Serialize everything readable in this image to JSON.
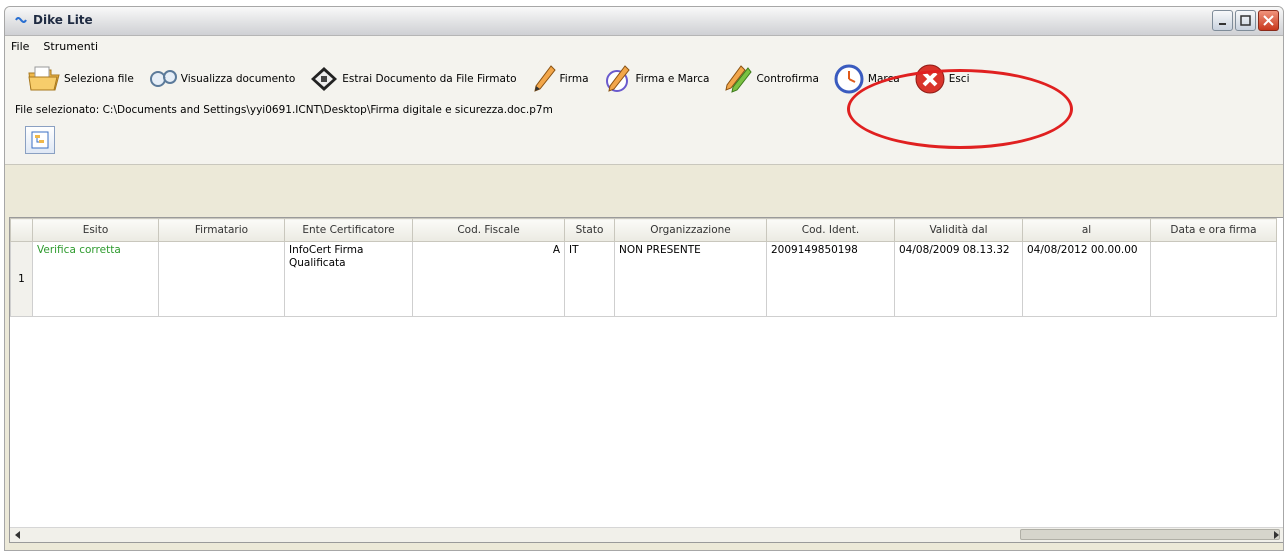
{
  "window": {
    "title": "Dike Lite"
  },
  "menu": {
    "file": "File",
    "tools": "Strumenti"
  },
  "toolbar": {
    "select_file": "Seleziona file",
    "view_document": "Visualizza documento",
    "extract_document": "Estrai Documento da File Firmato",
    "sign": "Firma",
    "sign_and_stamp": "Firma e Marca",
    "countersign": "Controfirma",
    "stamp": "Marca",
    "exit": "Esci"
  },
  "file_bar": {
    "text": "File selezionato: C:\\Documents and Settings\\yyi0691.ICNT\\Desktop\\Firma digitale e sicurezza.doc.p7m"
  },
  "table": {
    "headers": [
      "Esito",
      "Firmatario",
      "Ente Certificatore",
      "Cod. Fiscale",
      "Stato",
      "Organizzazione",
      "Cod. Ident.",
      "Validità dal",
      "al",
      "Data e ora firma"
    ],
    "rows": [
      {
        "num": "1",
        "esito": "Verifica corretta",
        "firmatario": "",
        "ente": "InfoCert Firma Qualificata",
        "cod_fiscale": "A",
        "stato": "IT",
        "organizzazione": "NON PRESENTE",
        "cod_ident": "2009149850198",
        "validita_dal": "04/08/2009 08.13.32",
        "al": "04/08/2012 00.00.00",
        "data_firma": ""
      }
    ]
  },
  "colors": {
    "annotation": "#e02020",
    "success_text": "#2e9b2e"
  }
}
